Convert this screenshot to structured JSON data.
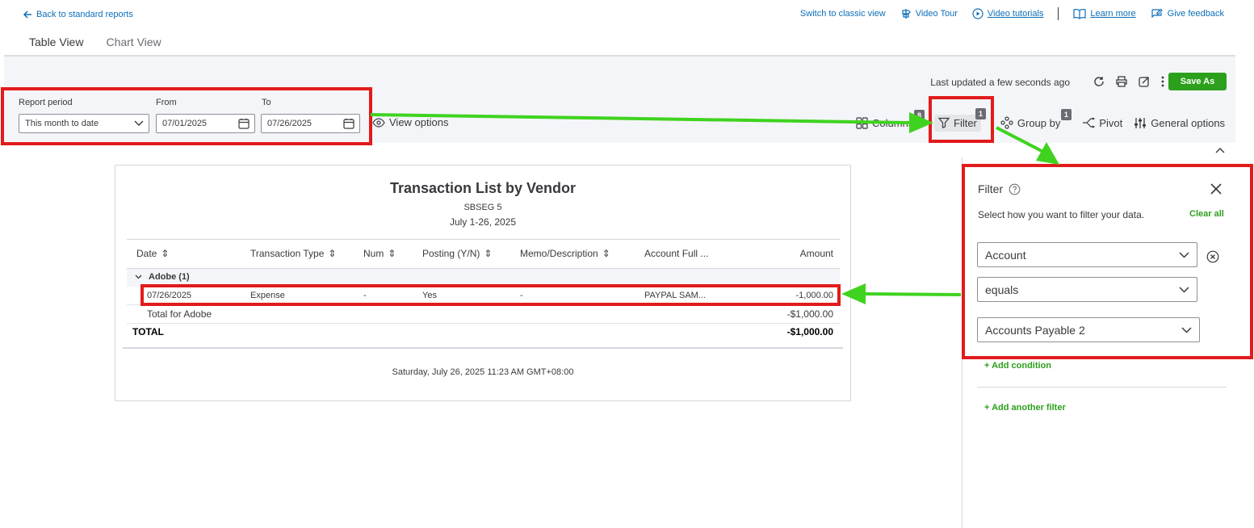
{
  "top_bar": {
    "back_label": "Back to standard reports",
    "switch_classic": "Switch to classic view",
    "video_tour": "Video Tour",
    "video_tutorials": "Video tutorials",
    "learn_more": "Learn more",
    "give_feedback": "Give feedback"
  },
  "tabs": [
    {
      "label": "Table View",
      "active": true
    },
    {
      "label": "Chart View",
      "active": false
    }
  ],
  "toolbar": {
    "last_updated": "Last updated a few seconds ago",
    "save_label": "Save As"
  },
  "report_period": {
    "label": "Report period",
    "value": "This month to date",
    "from_label": "From",
    "from_value": "07/01/2025",
    "to_label": "To",
    "to_value": "07/26/2025",
    "view_options": "View options"
  },
  "controls": {
    "columns_label": "Columns",
    "columns_count": "8",
    "filter_label": "Filter",
    "filter_count": "1",
    "group_by_label": "Group by",
    "group_by_count": "1",
    "pivot_label": "Pivot",
    "general_options_label": "General options"
  },
  "report": {
    "title": "Transaction List by Vendor",
    "company": "SBSEG 5",
    "period": "July 1-26, 2025",
    "columns": [
      "Date",
      "Transaction Type",
      "Num",
      "Posting (Y/N)",
      "Memo/Description",
      "Account Full ...",
      "Amount"
    ],
    "group_label": "Adobe (1)",
    "row": {
      "date": "07/26/2025",
      "type": "Expense",
      "num": "-",
      "posting": "Yes",
      "memo": "-",
      "account": "PAYPAL SAM...",
      "amount": "-1,000.00"
    },
    "subtotal_label": "Total for Adobe",
    "subtotal_amount": "-$1,000.00",
    "total_label": "TOTAL",
    "total_amount": "-$1,000.00",
    "footer": "Saturday, July 26, 2025 11:23 AM GMT+08:00"
  },
  "filter_panel": {
    "title": "Filter",
    "description": "Select how you want to filter your data.",
    "clear_all": "Clear all",
    "field": "Account",
    "operator": "equals",
    "value": "Accounts Payable 2",
    "add_condition": "+ Add condition",
    "add_another_filter": "+ Add another filter"
  },
  "colors": {
    "annotation_red": "#e21b1b",
    "annotation_green": "#3fd31f",
    "brand_green": "#2ca01c",
    "link_blue": "#0d6eb8"
  }
}
